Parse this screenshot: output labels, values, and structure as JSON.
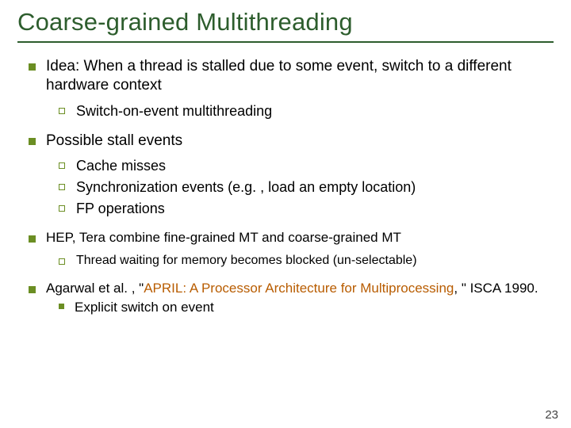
{
  "title": "Coarse-grained Multithreading",
  "b1": {
    "text": "Idea: When a thread is stalled due to some event, switch to a different hardware context",
    "sub": [
      "Switch-on-event multithreading"
    ]
  },
  "b2": {
    "text": "Possible stall events",
    "sub": [
      "Cache misses",
      "Synchronization events (e.g. , load an empty location)",
      "FP operations"
    ]
  },
  "b3": {
    "text": "HEP, Tera combine fine-grained MT and coarse-grained MT",
    "sub": [
      "Thread waiting for memory becomes blocked (un-selectable)"
    ]
  },
  "b4": {
    "prefix": "Agarwal et al. , \"",
    "ref": "APRIL: A Processor Architecture for Multiprocessing",
    "suffix": ", \" ISCA 1990.",
    "sub": [
      "Explicit switch on event"
    ]
  },
  "page": "23"
}
